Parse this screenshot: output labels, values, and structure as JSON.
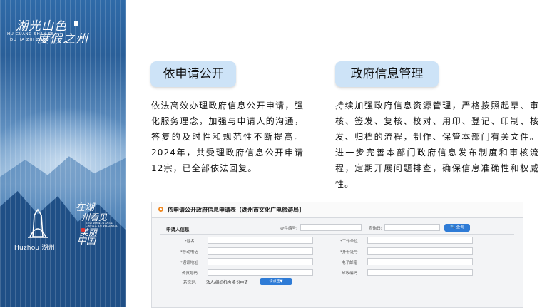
{
  "banner": {
    "title_cn_line1": "湖光山色",
    "title_cn_line2": "度假之州",
    "title_en_line1": "HU GUANG SHAN SE",
    "title_en_line2": "DU JIA ZHI ZHOU",
    "logo_text": "Huzhou 湖州",
    "callig_line1": "在湖",
    "callig_line2": "州看见",
    "callig_line3": "美丽",
    "callig_line4": "中国",
    "callig_small": "SEE BEAUTIFUL CHINA IN HUZHOU"
  },
  "cards": [
    {
      "title": "依申请公开",
      "text": "依法高效办理政府信息公开申请，强化服务理念，加强与申请人的沟通，答复的及时性和规范性不断提高。2024年，共受理政府信息公开申请12宗，已全部依法回复。"
    },
    {
      "title": "政府信息管理",
      "text": "持续加强政府信息资源管理，严格按照起草、审核、签发、复核、校对、用印、登记、印制、核发、归档的流程，制作、保管本部门有关文件。进一步完善本部门政府信息发布制度和审核流程，定期开展问题排查，确保信息准确性和权威性。"
    }
  ],
  "form": {
    "title": "依申请公开政府信息申请表【湖州市文化广电旅游局】",
    "section_label": "申请人信息",
    "code_label": "办件编号:",
    "query_code_label": "查询码:",
    "query_button": "查询",
    "fields_left": [
      "*姓名",
      "*移动电话",
      "*通讯地址",
      "传真号码"
    ],
    "fields_right": [
      "*工作单位",
      "*身份证号",
      "电子邮箱",
      "邮政编码"
    ],
    "bottom_label": "若您是:",
    "bottom_options": "法人/组织机构 身份申请",
    "select_button": "请点击▼"
  },
  "colors": {
    "banner_blue": "#2f6aa8",
    "pill_bg": "#cde3f7",
    "accent_orange": "#f08a24",
    "button_blue": "#2e7bd6"
  }
}
